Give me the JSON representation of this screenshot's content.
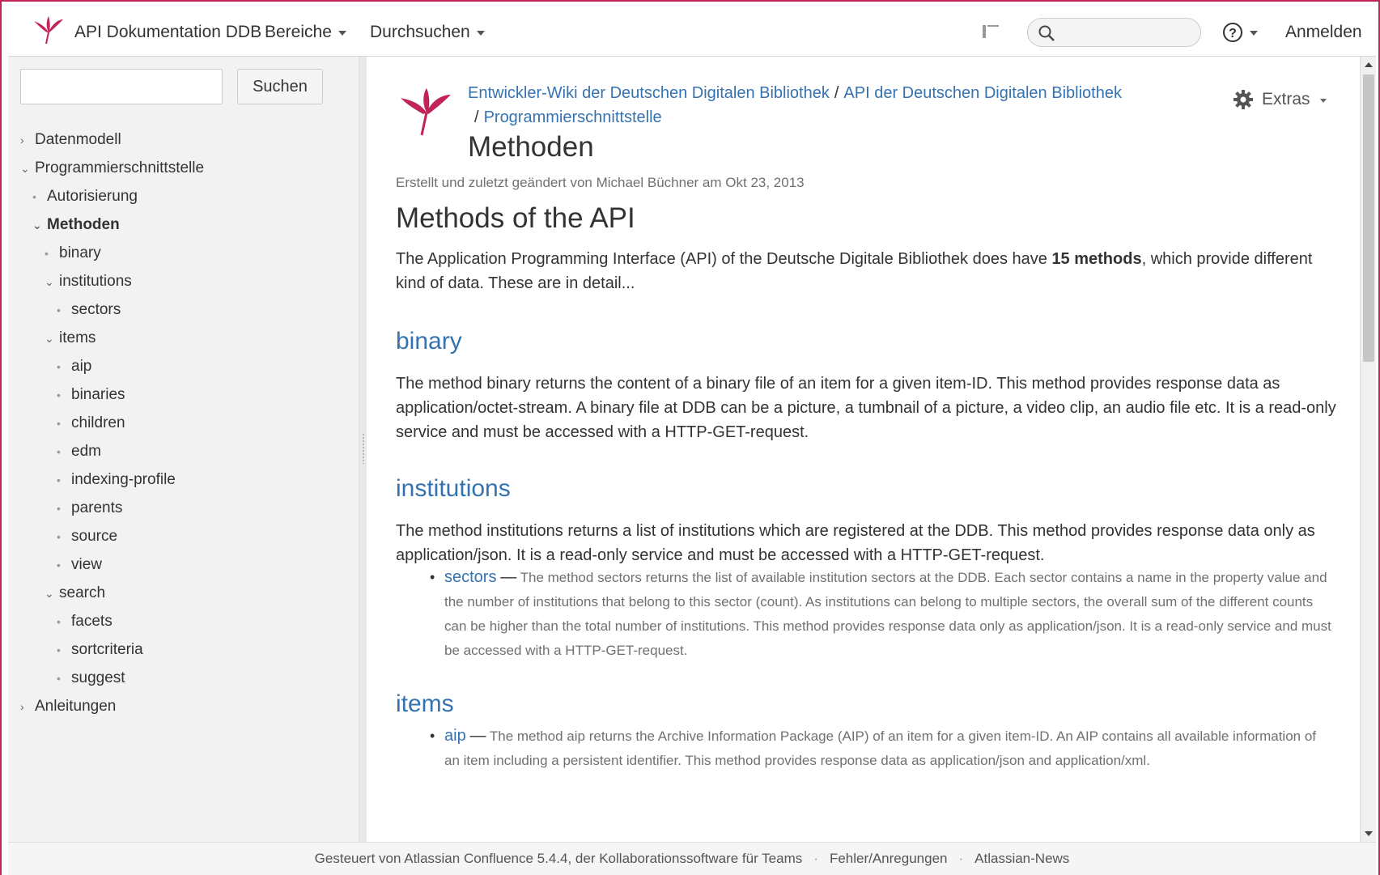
{
  "header": {
    "app_title": "API Dokumentation DDB",
    "menus": [
      "Bereiche",
      "Durchsuchen"
    ],
    "search_placeholder": "",
    "login_label": "Anmelden"
  },
  "sidebar": {
    "search_value": "",
    "search_button": "Suchen",
    "tree": [
      {
        "label": "Datenmodell",
        "marker": "›"
      },
      {
        "label": "Programmierschnittstelle",
        "marker": "⌄"
      },
      {
        "label": "Autorisierung",
        "marker": "•"
      },
      {
        "label": "Methoden",
        "marker": "⌄"
      },
      {
        "label": "binary",
        "marker": "•"
      },
      {
        "label": "institutions",
        "marker": "⌄"
      },
      {
        "label": "sectors",
        "marker": "•"
      },
      {
        "label": "items",
        "marker": "⌄"
      },
      {
        "label": "aip",
        "marker": "•"
      },
      {
        "label": "binaries",
        "marker": "•"
      },
      {
        "label": "children",
        "marker": "•"
      },
      {
        "label": "edm",
        "marker": "•"
      },
      {
        "label": "indexing-profile",
        "marker": "•"
      },
      {
        "label": "parents",
        "marker": "•"
      },
      {
        "label": "source",
        "marker": "•"
      },
      {
        "label": "view",
        "marker": "•"
      },
      {
        "label": "search",
        "marker": "⌄"
      },
      {
        "label": "facets",
        "marker": "•"
      },
      {
        "label": "sortcriteria",
        "marker": "•"
      },
      {
        "label": "suggest",
        "marker": "•"
      },
      {
        "label": "Anleitungen",
        "marker": "›"
      }
    ]
  },
  "breadcrumbs": {
    "crumb1": "Entwickler-Wiki der Deutschen Digitalen Bibliothek",
    "crumb2": "API der Deutschen Digitalen Bibliothek",
    "crumb3": "Programmierschnittstelle",
    "separator": "/"
  },
  "page": {
    "title": "Methoden",
    "extras_label": "Extras",
    "meta": "Erstellt und zuletzt geändert von Michael Büchner am Okt 23, 2013"
  },
  "content": {
    "heading": "Methods of the API",
    "intro_before": "The Application Programming Interface (API) of the Deutsche Digitale Bibliothek does have ",
    "intro_bold": "15 methods",
    "intro_after": ", which provide different kind of data. These are in detail...",
    "binary_heading": "binary",
    "binary_text": "The method binary returns the content of a binary file of an item for a given item-ID. This method provides response data as application/octet-stream. A binary file at DDB can be a picture, a tumbnail of a picture, a video clip, an audio file etc. It is a read-only service and must be accessed with a HTTP-GET-request.",
    "institutions_heading": "institutions",
    "institutions_text": "The method institutions returns a list of institutions which are registered at the DDB. This method provides response data only as application/json. It is a read-only service and must be accessed with a HTTP-GET-request.",
    "sectors_link": "sectors",
    "sectors_text": "The method sectors returns the list of available institution sectors at the DDB. Each sector contains a name in the property value and the number of institutions that belong to this sector (count). As institutions can belong to multiple sectors, the overall sum of the different counts can be higher than the total number of institutions. This method provides response data only as application/json. It is a read-only service and must be accessed with a HTTP-GET-request.",
    "items_heading": "items",
    "aip_link": "aip",
    "aip_text": "The method aip returns the Archive Information Package (AIP) of an item for a given item-ID. An AIP contains all available information of an item including a persistent identifier. This method provides response data as application/json and application/xml.",
    "dash": "—"
  },
  "footer": {
    "powered": "Gesteuert von Atlassian Confluence 5.4.4, der Kollaborationssoftware für Teams",
    "feedback": "Fehler/Anregungen",
    "news": "Atlassian-News",
    "separator": "·"
  },
  "colors": {
    "brand": "#c2245a",
    "link": "#3572b0"
  }
}
